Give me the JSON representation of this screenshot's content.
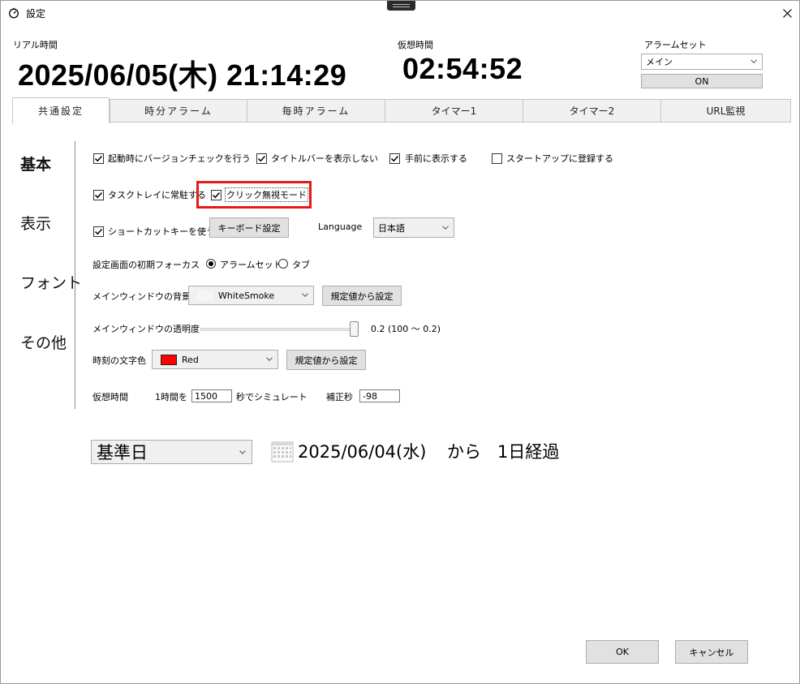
{
  "window": {
    "title": "設定"
  },
  "header": {
    "real_time_label": "リアル時間",
    "real_time_value": "2025/06/05(木) 21:14:29",
    "virtual_time_label": "仮想時間",
    "virtual_time_value": "02:54:52",
    "alarm_set_label": "アラームセット",
    "alarm_set_value": "メイン",
    "alarm_on_label": "ON"
  },
  "tabs": [
    {
      "label": "共通設定",
      "active": true
    },
    {
      "label": "時分アラーム",
      "active": false
    },
    {
      "label": "毎時アラーム",
      "active": false
    },
    {
      "label": "タイマー1",
      "active": false
    },
    {
      "label": "タイマー2",
      "active": false
    },
    {
      "label": "URL監視",
      "active": false
    }
  ],
  "nav": [
    {
      "label": "基本",
      "active": true
    },
    {
      "label": "表示",
      "active": false
    },
    {
      "label": "フォント",
      "active": false
    },
    {
      "label": "その他",
      "active": false
    }
  ],
  "options": {
    "version_check": {
      "label": "起動時にバージョンチェックを行う",
      "checked": true
    },
    "hide_titlebar": {
      "label": "タイトルバーを表示しない",
      "checked": true
    },
    "topmost": {
      "label": "手前に表示する",
      "checked": true
    },
    "startup": {
      "label": "スタートアップに登録する",
      "checked": false
    },
    "tasktray": {
      "label": "タスクトレイに常駐する",
      "checked": true
    },
    "click_through": {
      "label": "クリック無視モード",
      "checked": true
    },
    "shortcut": {
      "label": "ショートカットキーを使う",
      "checked": true
    }
  },
  "keyboard_button": "キーボード設定",
  "language": {
    "label": "Language",
    "value": "日本語"
  },
  "focus": {
    "label": "設定画面の初期フォーカス",
    "option_alarm": "アラームセット",
    "option_tab": "タブ",
    "selected": "alarm"
  },
  "bg_color": {
    "label": "メインウィンドウの背景色",
    "value": "WhiteSmoke",
    "swatch": "#f5f5f5",
    "reset_button": "規定値から設定"
  },
  "opacity": {
    "label": "メインウィンドウの透明度",
    "value_text": "0.2 (100 〜 0.2)",
    "level": 0.2
  },
  "text_color": {
    "label": "時刻の文字色",
    "value": "Red",
    "swatch": "#ff0000",
    "reset_button": "規定値から設定"
  },
  "virtual_time": {
    "label": "仮想時間",
    "per_hour_label": "1時間を",
    "seconds_value": "1500",
    "simulate_label": "秒でシミュレート",
    "correction_label": "補正秒",
    "correction_value": "-98"
  },
  "base_date": {
    "combo_value": "基準日",
    "date": "2025/06/04(水)",
    "from": "から",
    "elapsed": "1日経過"
  },
  "footer": {
    "ok": "OK",
    "cancel": "キャンセル"
  },
  "colors": {
    "highlight": "#e51919"
  }
}
